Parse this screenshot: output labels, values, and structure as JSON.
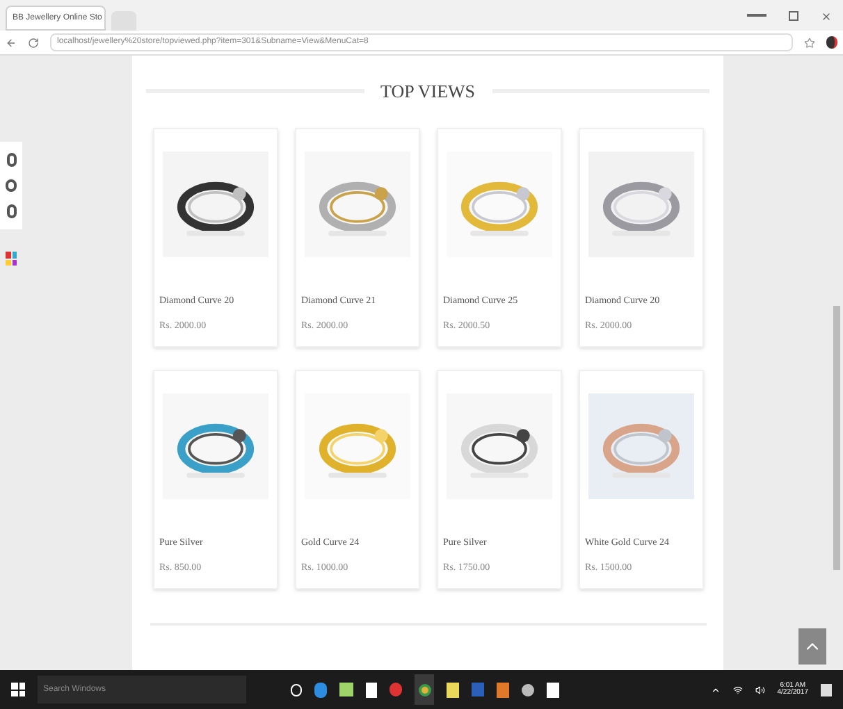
{
  "browser": {
    "tab_title": "BB Jewellery Online Sto",
    "address": "localhost/jewellery%20store/topviewed.php?item=301&Subname=View&MenuCat=8"
  },
  "section_title": "TOP VIEWS",
  "products": [
    {
      "name": "Diamond Curve 20",
      "price": "Rs. 2000.00"
    },
    {
      "name": "Diamond Curve 21",
      "price": "Rs. 2000.00"
    },
    {
      "name": "Diamond Curve 25",
      "price": "Rs. 2000.50"
    },
    {
      "name": "Diamond Curve 20",
      "price": "Rs. 2000.00"
    },
    {
      "name": "Pure Silver",
      "price": "Rs. 850.00"
    },
    {
      "name": "Gold Curve 24",
      "price": "Rs. 1000.00"
    },
    {
      "name": "Pure Silver",
      "price": "Rs. 1750.00"
    },
    {
      "name": "White Gold Curve 24",
      "price": "Rs. 1500.00"
    }
  ],
  "taskbar": {
    "search_placeholder": "Search Windows",
    "time": "6:01 AM",
    "date": "4/22/2017"
  }
}
